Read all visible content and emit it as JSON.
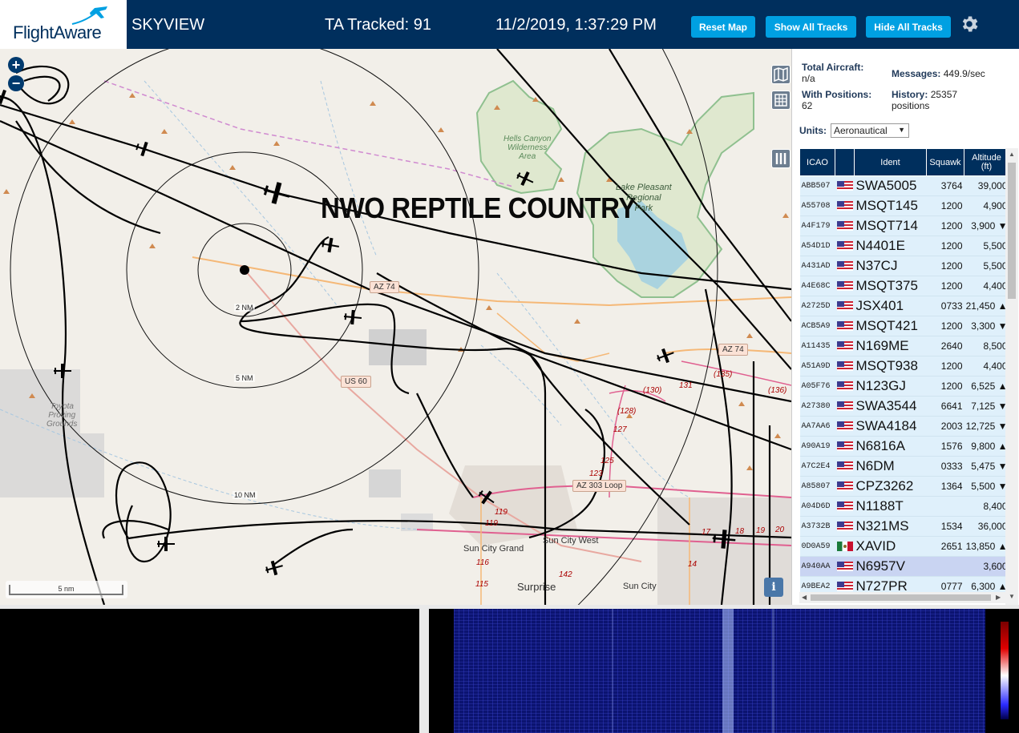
{
  "header": {
    "logo_text": "FlightAware",
    "app_name": "SKYVIEW",
    "tracked_label": "TA Tracked: 91",
    "datetime": "11/2/2019, 1:37:29 PM",
    "buttons": {
      "reset": "Reset Map",
      "show": "Show All Tracks",
      "hide": "Hide All Tracks"
    },
    "bg_color": "#002f5d",
    "button_color": "#00a0e2"
  },
  "map": {
    "overlay_title": "NWO REPTILE COUNTRY",
    "scale_label": "5 nm",
    "range_rings": [
      "2 NM",
      "5 NM",
      "10 NM"
    ],
    "labels": {
      "hells_canyon": "Hells Canyon\nWilderness\nArea",
      "lake_pleasant": "Lake Pleasant\nRegional\nPark",
      "toyota": "Toyota\nProving\nGrounds",
      "sun_city_grand": "Sun City Grand",
      "sun_city_west": "Sun City West",
      "sun_city": "Sun City",
      "surprise": "Surprise"
    },
    "shields": {
      "az74a": "AZ 74",
      "az74b": "AZ 74",
      "us60": "US 60",
      "az303": "AZ 303 Loop"
    },
    "road_numbers": [
      "(135)",
      "131",
      "(130)",
      "(136)",
      "(128)",
      "127",
      "125",
      "123",
      "119",
      "119",
      "116",
      "115",
      "142",
      "14",
      "17",
      "18",
      "19",
      "20"
    ],
    "info_label": "i"
  },
  "sidebar": {
    "total_aircraft_label": "Total Aircraft:",
    "total_aircraft_value": "n/a",
    "with_positions_label": "With Positions:",
    "with_positions_value": "62",
    "messages_label": "Messages:",
    "messages_value": "449.9/sec",
    "history_label": "History:",
    "history_value": "25357 positions",
    "units_label": "Units:",
    "units_value": "Aeronautical",
    "columns": {
      "icao": "ICAO",
      "ident": "Ident",
      "squawk": "Squawk",
      "altitude": "Altitude (ft)"
    },
    "rows": [
      {
        "icao": "ABB507",
        "flag": "us",
        "ident": "SWA5005",
        "squawk": "3764",
        "alt": "39,000"
      },
      {
        "icao": "A55708",
        "flag": "us",
        "ident": "MSQT145",
        "squawk": "1200",
        "alt": "4,900"
      },
      {
        "icao": "A4F179",
        "flag": "us",
        "ident": "MSQT714",
        "squawk": "1200",
        "alt": "3,900 ▼"
      },
      {
        "icao": "A54D1D",
        "flag": "us",
        "ident": "N4401E",
        "squawk": "1200",
        "alt": "5,500"
      },
      {
        "icao": "A431AD",
        "flag": "us",
        "ident": "N37CJ",
        "squawk": "1200",
        "alt": "5,500"
      },
      {
        "icao": "A4E68C",
        "flag": "us",
        "ident": "MSQT375",
        "squawk": "1200",
        "alt": "4,400"
      },
      {
        "icao": "A2725D",
        "flag": "us",
        "ident": "JSX401",
        "squawk": "0733",
        "alt": "21,450 ▲"
      },
      {
        "icao": "ACB5A9",
        "flag": "us",
        "ident": "MSQT421",
        "squawk": "1200",
        "alt": "3,300 ▼"
      },
      {
        "icao": "A11435",
        "flag": "us",
        "ident": "N169ME",
        "squawk": "2640",
        "alt": "8,500"
      },
      {
        "icao": "A51A9D",
        "flag": "us",
        "ident": "MSQT938",
        "squawk": "1200",
        "alt": "4,400"
      },
      {
        "icao": "A05F76",
        "flag": "us",
        "ident": "N123GJ",
        "squawk": "1200",
        "alt": "6,525 ▲"
      },
      {
        "icao": "A27380",
        "flag": "us",
        "ident": "SWA3544",
        "squawk": "6641",
        "alt": "7,125 ▼"
      },
      {
        "icao": "AA7AA6",
        "flag": "us",
        "ident": "SWA4184",
        "squawk": "2003",
        "alt": "12,725 ▼"
      },
      {
        "icao": "A90A19",
        "flag": "us",
        "ident": "N6816A",
        "squawk": "1576",
        "alt": "9,800 ▲"
      },
      {
        "icao": "A7C2E4",
        "flag": "us",
        "ident": "N6DM",
        "squawk": "0333",
        "alt": "5,475 ▼"
      },
      {
        "icao": "A85807",
        "flag": "us",
        "ident": "CPZ3262",
        "squawk": "1364",
        "alt": "5,500 ▼"
      },
      {
        "icao": "A04D6D",
        "flag": "us",
        "ident": "N1188T",
        "squawk": "",
        "alt": "8,400"
      },
      {
        "icao": "A3732B",
        "flag": "us",
        "ident": "N321MS",
        "squawk": "1534",
        "alt": "36,000"
      },
      {
        "icao": "0D0A59",
        "flag": "mx",
        "ident": "XAVID",
        "squawk": "2651",
        "alt": "13,850 ▲"
      },
      {
        "icao": "A940AA",
        "flag": "us",
        "ident": "N6957V",
        "squawk": "",
        "alt": "3,600",
        "selected": true
      },
      {
        "icao": "A9BEA2",
        "flag": "us",
        "ident": "N727PR",
        "squawk": "0777",
        "alt": "6,300 ▲"
      }
    ]
  }
}
